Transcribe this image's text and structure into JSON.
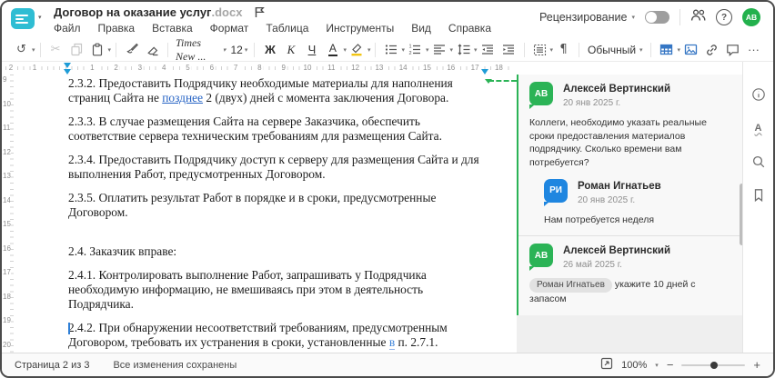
{
  "header": {
    "title": "Договор на оказание услуг",
    "title_ext": ".docx",
    "menu": [
      "Файл",
      "Правка",
      "Вставка",
      "Формат",
      "Таблица",
      "Инструменты",
      "Вид",
      "Справка"
    ],
    "review": "Рецензирование",
    "avatar": "АВ"
  },
  "toolbar": {
    "font": "Times New ...",
    "size": "12",
    "bold": "Ж",
    "italic": "К",
    "underline": "Ч",
    "font_color": "А",
    "style": "Обычный"
  },
  "icons": {
    "undo": "↺",
    "cut": "✂",
    "pilcrow": "¶",
    "more": "···",
    "caret": "▾",
    "question": "?",
    "info": "i",
    "spell": "А",
    "minus": "−",
    "plus": "+"
  },
  "ruler": {
    "left_numbers": [
      "2",
      "1"
    ],
    "numbers": [
      "1",
      "2",
      "3",
      "4",
      "5",
      "6",
      "7",
      "8",
      "9",
      "10",
      "11",
      "12",
      "13",
      "14",
      "15",
      "16",
      "17",
      "18"
    ],
    "vertical_numbers": [
      "9",
      "10",
      "11",
      "12",
      "13",
      "14",
      "15",
      "16",
      "17",
      "18",
      "19",
      "20"
    ]
  },
  "document": {
    "p232_before": "2.3.2. Предоставить Подрядчику необходимые материалы для наполнения страниц Сайта не ",
    "p232_marked": "позднее",
    "p232_after": " 2 (двух) дней с момента заключения Договора.",
    "p233": "2.3.3. В случае размещения Сайта на сервере Заказчика, обеспечить соответствие сервера техническим требованиям для размещения Сайта.",
    "p234": "2.3.4. Предоставить Подрядчику доступ к серверу для размещения Сайта и для выполнения Работ, предусмотренных Договором.",
    "p235": "2.3.5. Оплатить результат Работ в порядке и в сроки, предусмотренные Договором.",
    "p24": "2.4. Заказчик вправе:",
    "p241": "2.4.1. Контролировать выполнение Работ, запрашивать у Подрядчика необходимую информацию, не вмешиваясь при этом в деятельность Подрядчика.",
    "p242_before": "2.4.2. При обнаружении несоответствий требованиям, предусмотренным Договором, требовать их устранения в сроки, установленные ",
    "p242_marked": "в",
    "p242_after": " п. 2.7.1."
  },
  "comments": {
    "c1_initials": "АВ",
    "c1_author": "Алексей Вертинский",
    "c1_date": "20 янв 2025 г.",
    "c1_text": "Коллеги, необходимо указать реальные сроки предоставления материалов подрядчику. Сколько времени вам потребуется?",
    "r1_initials": "РИ",
    "r1_author": "Роман Игнатьев",
    "r1_date": "20 янв 2025 г.",
    "r1_text": "Нам потребуется неделя",
    "c2_initials": "АВ",
    "c2_author": "Алексей Вертинский",
    "c2_date": "26 май 2025 г.",
    "c2_mention": "Роман Игнатьев",
    "c2_text": "укажите 10 дней с запасом"
  },
  "statusbar": {
    "page": "Страница 2 из 3",
    "saved": "Все изменения сохранены",
    "zoom": "100%"
  }
}
